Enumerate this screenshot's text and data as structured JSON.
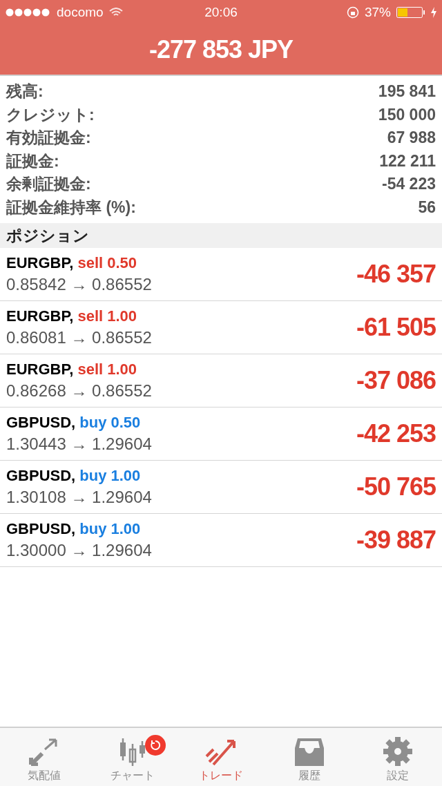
{
  "status_bar": {
    "carrier": "docomo",
    "time": "20:06",
    "battery": "37%"
  },
  "header": {
    "total": "-277 853 JPY"
  },
  "summary": [
    {
      "label": "残高:",
      "value": "195 841"
    },
    {
      "label": "クレジット:",
      "value": "150 000"
    },
    {
      "label": "有効証拠金:",
      "value": "67 988"
    },
    {
      "label": "証拠金:",
      "value": "122 211"
    },
    {
      "label": "余剰証拠金:",
      "value": "-54 223"
    },
    {
      "label": "証拠金維持率 (%):",
      "value": "56"
    }
  ],
  "positions_section": {
    "title": "ポジション"
  },
  "positions": [
    {
      "symbol": "EURGBP,",
      "kind": "sell",
      "order": "sell 0.50",
      "prices": "0.85842 → 0.86552",
      "profit": "-46 357"
    },
    {
      "symbol": "EURGBP,",
      "kind": "sell",
      "order": "sell 1.00",
      "prices": "0.86081 → 0.86552",
      "profit": "-61 505"
    },
    {
      "symbol": "EURGBP,",
      "kind": "sell",
      "order": "sell 1.00",
      "prices": "0.86268 → 0.86552",
      "profit": "-37 086"
    },
    {
      "symbol": "GBPUSD,",
      "kind": "buy",
      "order": "buy 0.50",
      "prices": "1.30443 → 1.29604",
      "profit": "-42 253"
    },
    {
      "symbol": "GBPUSD,",
      "kind": "buy",
      "order": "buy 1.00",
      "prices": "1.30108 → 1.29604",
      "profit": "-50 765"
    },
    {
      "symbol": "GBPUSD,",
      "kind": "buy",
      "order": "buy 1.00",
      "prices": "1.30000 → 1.29604",
      "profit": "-39 887"
    }
  ],
  "tabs": [
    {
      "label": "気配値",
      "kind": "quotes",
      "selected": false,
      "badge": false
    },
    {
      "label": "チャート",
      "kind": "chart",
      "selected": false,
      "badge": true
    },
    {
      "label": "トレード",
      "kind": "trade",
      "selected": true,
      "badge": false
    },
    {
      "label": "履歴",
      "kind": "history",
      "selected": false,
      "badge": false
    },
    {
      "label": "設定",
      "kind": "settings",
      "selected": false,
      "badge": false
    }
  ]
}
